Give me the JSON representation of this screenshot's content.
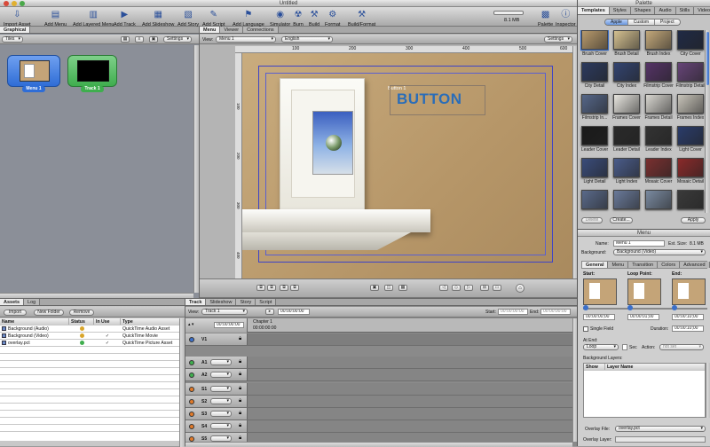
{
  "window": {
    "title": "Untitled"
  },
  "palette_window": {
    "title": "Palette"
  },
  "toolbar": {
    "items": [
      {
        "label": "Import Asset",
        "icon": "import-icon"
      },
      {
        "label": "Add Menu",
        "icon": "add-menu-icon"
      },
      {
        "label": "Add Layered Menu",
        "icon": "add-layered-menu-icon"
      },
      {
        "label": "Add Track",
        "icon": "add-track-icon"
      },
      {
        "label": "Add Slideshow",
        "icon": "add-slideshow-icon"
      },
      {
        "label": "Add Story",
        "icon": "add-story-icon"
      },
      {
        "label": "Add Script",
        "icon": "add-script-icon"
      },
      {
        "label": "Add Language",
        "icon": "add-language-icon"
      },
      {
        "label": "Simulator",
        "icon": "simulator-icon"
      },
      {
        "label": "Burn",
        "icon": "burn-icon"
      },
      {
        "label": "Build",
        "icon": "build-icon"
      },
      {
        "label": "Format",
        "icon": "format-icon"
      },
      {
        "label": "Build/Format",
        "icon": "build-format-icon"
      },
      {
        "label": "Palette",
        "icon": "palette-icon"
      },
      {
        "label": "Inspector",
        "icon": "inspector-icon"
      }
    ],
    "disk_size": "8.1 MB"
  },
  "graphical": {
    "tab": "Graphical",
    "view_select": "Tiles",
    "settings": "Settings",
    "tiles": [
      {
        "label": "Menu 1",
        "color": "#2f6dd6"
      },
      {
        "label": "Track 1",
        "color": "#3fae4e"
      }
    ]
  },
  "editor": {
    "tabs": [
      "Menu",
      "Viewer",
      "Connections"
    ],
    "view_label": "View:",
    "view_value": "Menu 1",
    "language_value": "English",
    "settings": "Settings",
    "ruler_top": [
      "100",
      "200",
      "300",
      "400",
      "500",
      "600"
    ],
    "ruler_left": [
      "100",
      "200",
      "300",
      "400"
    ],
    "button_small_label": "Button 1",
    "button_big_label": "BUTTON"
  },
  "assets": {
    "tabs": [
      "Assets",
      "Log"
    ],
    "buttons": {
      "import": "Import",
      "new_folder": "New Folder",
      "remove": "Remove"
    },
    "columns": [
      "Name",
      "Status",
      "In Use",
      "Type"
    ],
    "rows": [
      {
        "name": "Background (Audio)",
        "in_use": "",
        "type": "QuickTime Audio Asset",
        "icon": "audio-file-icon",
        "status_color": "#d9a52b"
      },
      {
        "name": "Background (Video)",
        "in_use": "✓",
        "type": "QuickTime Movie",
        "icon": "video-file-icon",
        "status_color": "#d9a52b"
      },
      {
        "name": "overlay.pct",
        "in_use": "✓",
        "type": "QuickTime Picture Asset",
        "icon": "picture-file-icon",
        "status_color": "#3fae4e"
      }
    ]
  },
  "timeline": {
    "tabs": [
      "Track",
      "Slideshow",
      "Story",
      "Script"
    ],
    "view_label": "View:",
    "view_value": "Track 1",
    "timecode": "00:00:00:00",
    "start_label": "Start:",
    "start_value": "00:00:00:00",
    "end_label": "End:",
    "end_value": "00:00:00:00",
    "ruler_timecode": "00:00:00:00",
    "chapter": "Chapter 1",
    "chapter_time": "00:00:00:00",
    "rows": [
      "V1",
      "A1",
      "A2",
      "S1",
      "S2",
      "S3",
      "S4",
      "S5"
    ]
  },
  "palette": {
    "tabs": [
      "Templates",
      "Styles",
      "Shapes",
      "Audio",
      "Stills",
      "Video"
    ],
    "subtabs": [
      "Apple",
      "Custom",
      "Project"
    ],
    "templates": [
      {
        "name": "Brush Cover",
        "color": "#b89a6c"
      },
      {
        "name": "Brush Detail",
        "color": "#d4c090"
      },
      {
        "name": "Brush Index",
        "color": "#c3a87a"
      },
      {
        "name": "City Cover",
        "color": "#202a45"
      },
      {
        "name": "City Detail",
        "color": "#2c3a5e"
      },
      {
        "name": "City Index",
        "color": "#334470"
      },
      {
        "name": "Filmstrip Cover",
        "color": "#553366"
      },
      {
        "name": "Filmstrip Detail",
        "color": "#664477"
      },
      {
        "name": "Filmstrip In...",
        "color": "#556688"
      },
      {
        "name": "Frames Cover",
        "color": "#e8e6e0"
      },
      {
        "name": "Frames Detail",
        "color": "#d8d6d0"
      },
      {
        "name": "Frames Index",
        "color": "#c8c4ba"
      },
      {
        "name": "Leader Cover",
        "color": "#1a1a1a"
      },
      {
        "name": "Leader Detail",
        "color": "#2a2a2a"
      },
      {
        "name": "Leader Index",
        "color": "#333333"
      },
      {
        "name": "Light Cover",
        "color": "#2a3c6a"
      },
      {
        "name": "Light Detail",
        "color": "#3a4c7a"
      },
      {
        "name": "Light Index",
        "color": "#4a5c8a"
      },
      {
        "name": "Mosaic Cover",
        "color": "#7a3030"
      },
      {
        "name": "Mosaic Detail",
        "color": "#8a2a2a"
      },
      {
        "name": "",
        "color": "#5a6a8a"
      },
      {
        "name": "",
        "color": "#6a7a9a"
      },
      {
        "name": "",
        "color": "#7a8aa0"
      },
      {
        "name": "",
        "color": "#3a3a3a"
      }
    ],
    "delete": "Delete",
    "create": "Create...",
    "apply": "Apply"
  },
  "inspector": {
    "title": "Menu",
    "name_label": "Name:",
    "name_value": "Menu 1",
    "est_size_label": "Est. Size:",
    "est_size_value": "8.1 MB",
    "background_label": "Background:",
    "background_value": "Background (Video)",
    "tabs": [
      "General",
      "Menu",
      "Transition",
      "Colors",
      "Advanced"
    ],
    "start_label": "Start:",
    "loop_label": "Loop Point:",
    "end_label": "End:",
    "start_time": "00:00:00;00",
    "loop_time": "00:00:01;00",
    "end_time": "00:00:10;00",
    "single_field": "Single Field",
    "duration_label": "Duration:",
    "duration_value": "00:00:10;00",
    "at_end_label": "At End:",
    "at_end_value": "Loop",
    "sec_label": "Sec",
    "action_label": "Action:",
    "action_value": "not set",
    "bg_layers_label": "Background Layers:",
    "layer_columns": [
      "Show",
      "Layer Name"
    ],
    "overlay_file_label": "Overlay File:",
    "overlay_file_value": "overlay.pct",
    "overlay_layer_label": "Overlay Layer:"
  },
  "colors": {
    "accent": "#3b6fc9",
    "button_text": "#2a6db8"
  }
}
